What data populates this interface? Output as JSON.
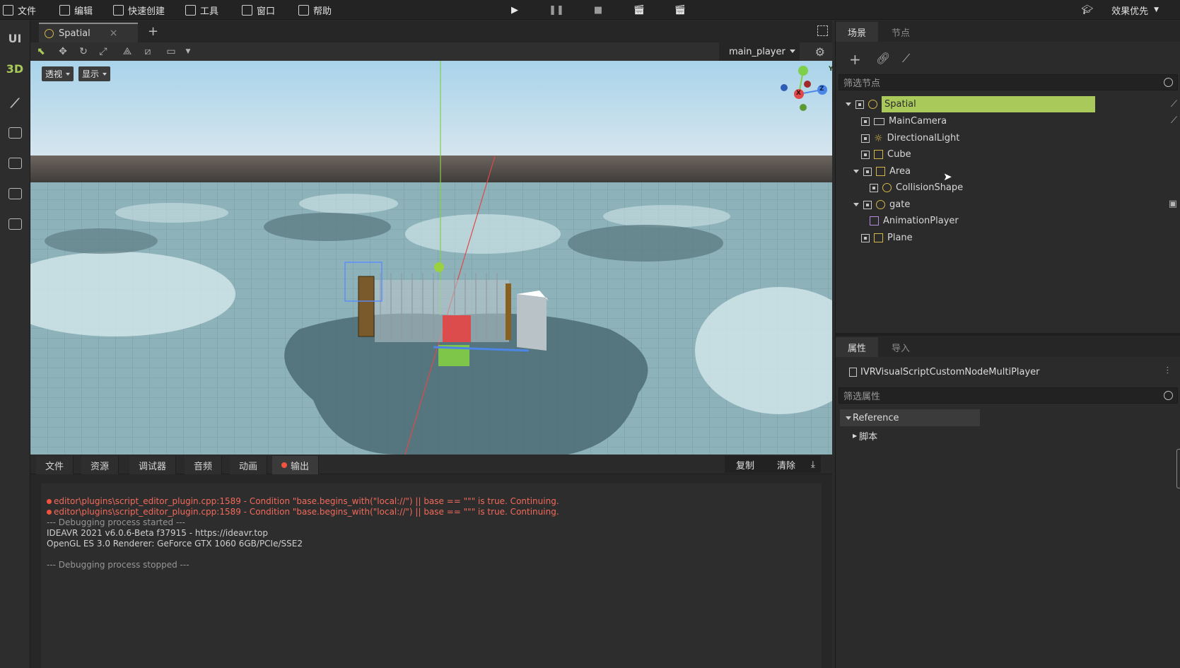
{
  "menu": {
    "items": [
      {
        "label": "文件",
        "icon": "folder-icon"
      },
      {
        "label": "编辑",
        "icon": "crop-icon"
      },
      {
        "label": "快速创建",
        "icon": "edit-icon"
      },
      {
        "label": "工具",
        "icon": "window-icon"
      },
      {
        "label": "窗口",
        "icon": "frame-icon"
      },
      {
        "label": "帮助",
        "icon": "doc-icon"
      }
    ],
    "quality_label": "效果优先"
  },
  "left_bar": {
    "ui_label": "UI",
    "three_d_label": "3D"
  },
  "editor_tab": {
    "label": "Spatial",
    "close": "×",
    "add": "+"
  },
  "viewport": {
    "player_select": "main_player",
    "perspective_label": "透视",
    "display_label": "显示",
    "gizmo_axes": {
      "x": "X",
      "y": "Y",
      "z": "Z"
    }
  },
  "bottom": {
    "tabs": [
      "文件",
      "资源",
      "调试器",
      "音频",
      "动画",
      "输出"
    ],
    "copy_label": "复制",
    "clear_label": "清除",
    "log": [
      {
        "text": "editor\\plugins\\script_editor_plugin.cpp:1589 - Condition \"base.begins_with(\"local://\") || base == \"\"\" is true. Continuing.",
        "kind": "err"
      },
      {
        "text": "editor\\plugins\\script_editor_plugin.cpp:1589 - Condition \"base.begins_with(\"local://\") || base == \"\"\" is true. Continuing.",
        "kind": "err"
      },
      {
        "text": "--- Debugging process started ---",
        "kind": "dim"
      },
      {
        "text": "IDEAVR 2021 v6.0.6-Beta f37915 - https://ideavr.top",
        "kind": "info"
      },
      {
        "text": "OpenGL ES 3.0 Renderer: GeForce GTX 1060 6GB/PCIe/SSE2",
        "kind": "info"
      },
      {
        "text": "",
        "kind": "info"
      },
      {
        "text": "--- Debugging process stopped ---",
        "kind": "dim"
      }
    ]
  },
  "scene_panel": {
    "tab_scene": "场景",
    "tab_node": "节点",
    "filter_placeholder": "筛选节点",
    "nodes": [
      {
        "label": "Spatial",
        "depth": 0,
        "expanded": true,
        "selected": true,
        "icon": "spatial-icon"
      },
      {
        "label": "MainCamera",
        "depth": 1,
        "icon": "camera-icon"
      },
      {
        "label": "DirectionalLight",
        "depth": 1,
        "icon": "light-icon"
      },
      {
        "label": "Cube",
        "depth": 1,
        "icon": "mesh-icon"
      },
      {
        "label": "Area",
        "depth": 1,
        "expanded": true,
        "icon": "area-icon"
      },
      {
        "label": "CollisionShape",
        "depth": 2,
        "icon": "collision-icon"
      },
      {
        "label": "gate",
        "depth": 1,
        "expanded": true,
        "icon": "spatial-icon"
      },
      {
        "label": "AnimationPlayer",
        "depth": 2,
        "icon": "animation-icon"
      },
      {
        "label": "Plane",
        "depth": 1,
        "icon": "mesh-icon"
      }
    ]
  },
  "property_panel": {
    "tab_props": "属性",
    "tab_import": "导入",
    "object_name": "IVRVisualScriptCustomNodeMultiPlayer",
    "filter_placeholder": "筛选属性",
    "section": "Reference",
    "subsection": "脚本"
  },
  "colors": {
    "accent": "#a9c95a",
    "error": "#f26a5a",
    "background": "#2b2b2b"
  }
}
